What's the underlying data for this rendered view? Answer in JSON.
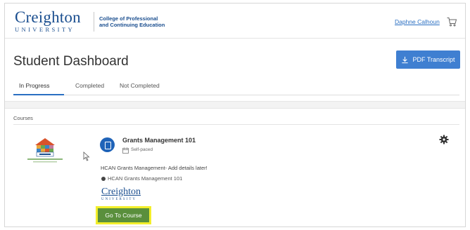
{
  "header": {
    "logo_main": "Creighton",
    "logo_sub": "UNIVERSITY",
    "college_line1": "College of Professional",
    "college_line2": "and Continuing Education",
    "user_name": "Daphne Calhoun",
    "cart_icon": "cart-icon"
  },
  "page": {
    "title": "Student Dashboard",
    "pdf_button": "PDF Transcript"
  },
  "tabs": [
    {
      "label": "In Progress",
      "active": true
    },
    {
      "label": "Completed",
      "active": false
    },
    {
      "label": "Not Completed",
      "active": false
    }
  ],
  "courses": {
    "section_label": "Courses",
    "items": [
      {
        "title": "Grants Management 101",
        "pace": "Self-paced",
        "description": "HCAN Grants Management- Add details later!",
        "course_item": "HCAN Grants Management 101",
        "provider_logo_main": "Creighton",
        "provider_logo_sub": "UNIVERSITY",
        "go_button": "Go To Course"
      }
    ]
  },
  "colors": {
    "brand_blue": "#1a4e8f",
    "accent_blue": "#3f7fd1",
    "go_green": "#5a8f3c",
    "highlight_yellow": "#f2ee2a"
  }
}
